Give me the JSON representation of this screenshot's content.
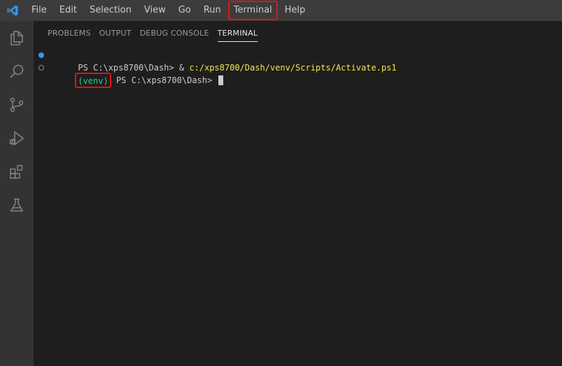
{
  "titlebar": {
    "menu": [
      {
        "label": "File",
        "name": "menu-file"
      },
      {
        "label": "Edit",
        "name": "menu-edit"
      },
      {
        "label": "Selection",
        "name": "menu-selection"
      },
      {
        "label": "View",
        "name": "menu-view"
      },
      {
        "label": "Go",
        "name": "menu-go"
      },
      {
        "label": "Run",
        "name": "menu-run"
      },
      {
        "label": "Terminal",
        "name": "menu-terminal"
      },
      {
        "label": "Help",
        "name": "menu-help"
      }
    ]
  },
  "activitybar": {
    "icons": [
      "explorer-icon",
      "search-icon",
      "source-control-icon",
      "run-debug-icon",
      "extensions-icon",
      "testing-icon"
    ]
  },
  "panel": {
    "tabs": [
      "PROBLEMS",
      "OUTPUT",
      "DEBUG CONSOLE",
      "TERMINAL"
    ],
    "active_tab": "TERMINAL"
  },
  "terminal": {
    "line1_prompt": "PS C:\\xps8700\\Dash> & ",
    "line1_command": "c:/xps8700/Dash/venv/Scripts/Activate.ps1",
    "line2_venv": "(venv)",
    "line2_prompt": " PS C:\\xps8700\\Dash> "
  },
  "colors": {
    "highlight_box": "#e0141a",
    "venv_green": "#23d18b",
    "command_yellow": "#f0e44f",
    "vscode_blue": "#3794ff"
  }
}
